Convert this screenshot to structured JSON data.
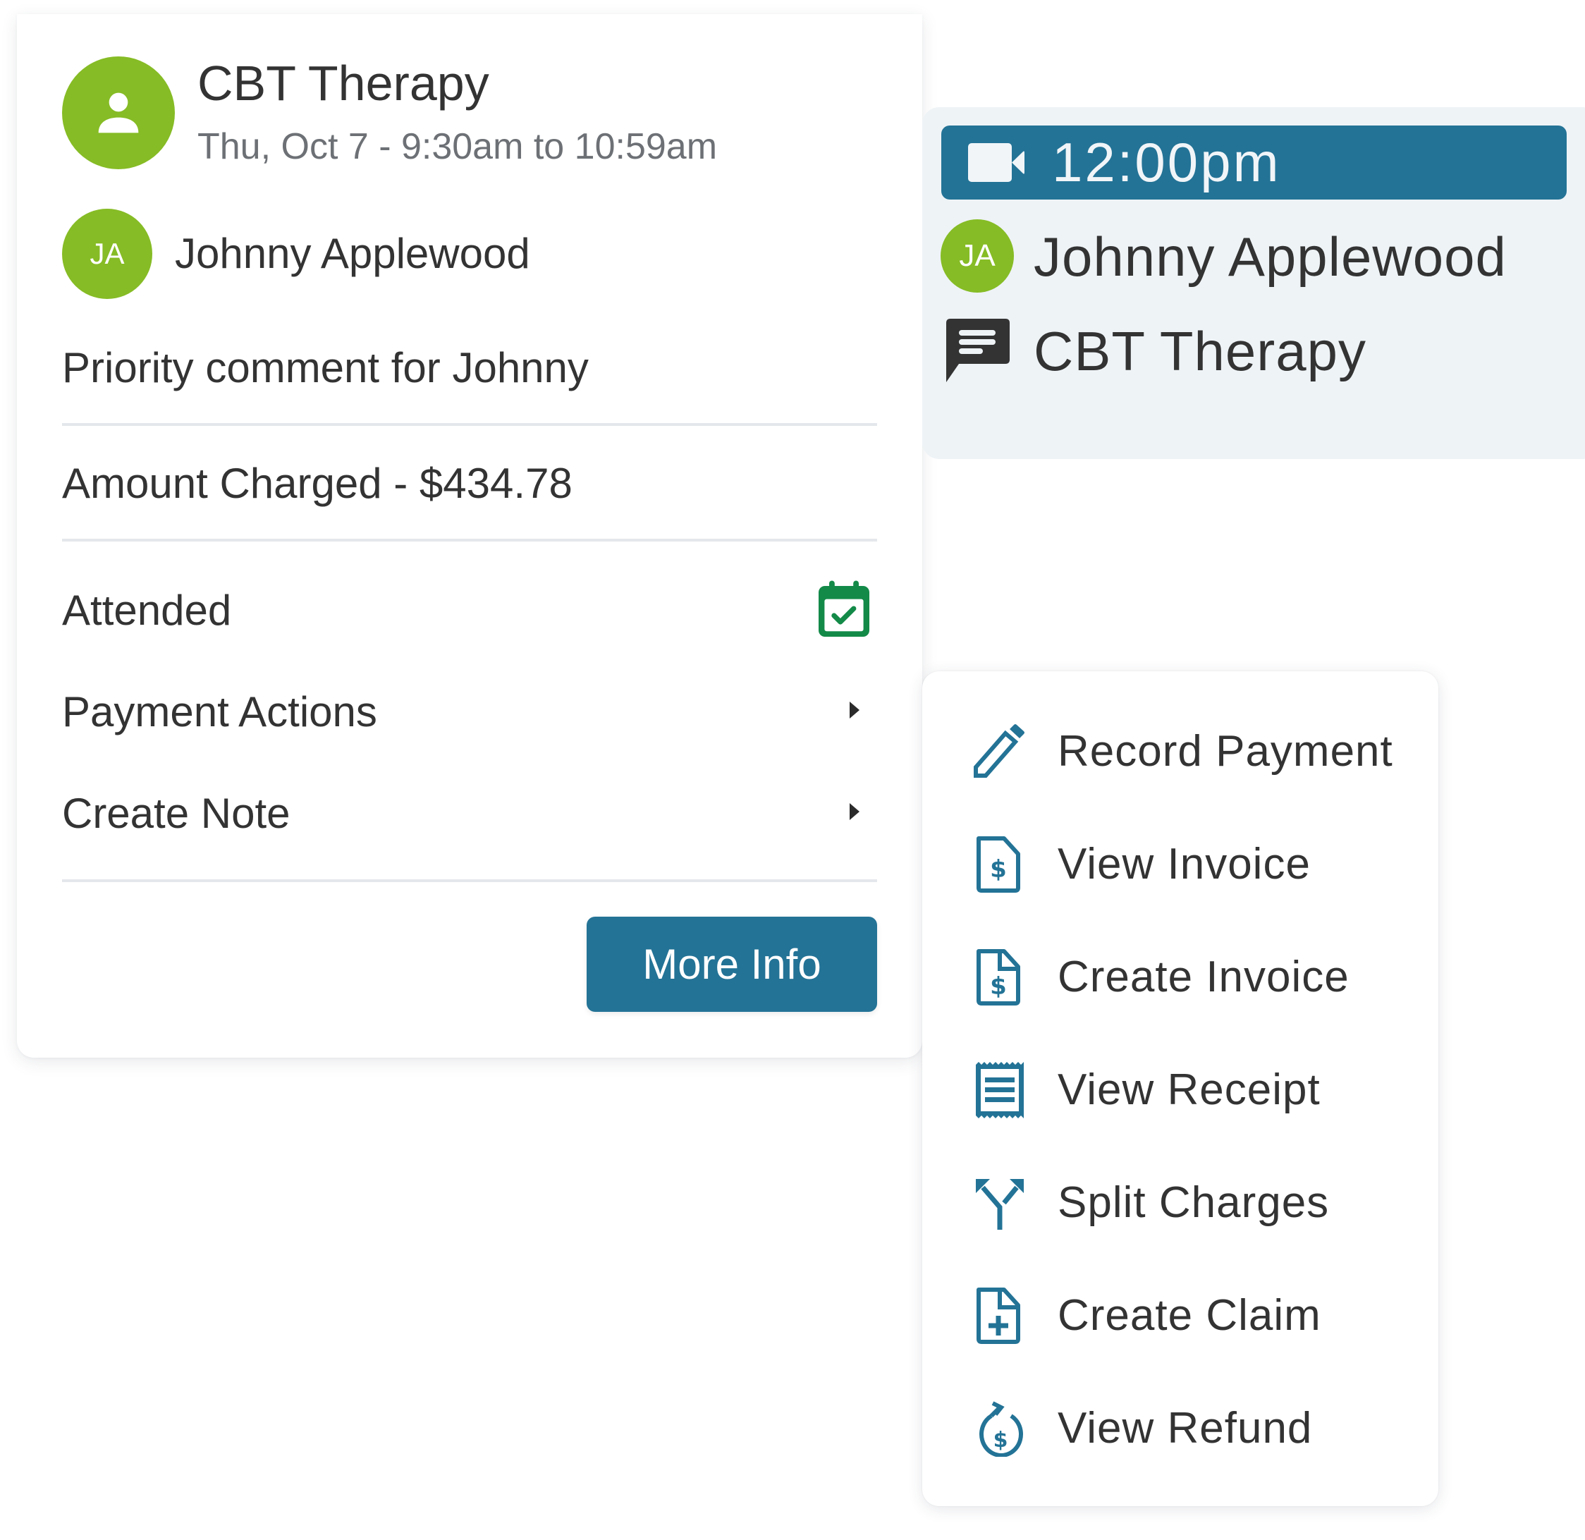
{
  "appointment_card": {
    "service_title": "CBT Therapy",
    "datetime": "Thu, Oct 7 - 9:30am to 10:59am",
    "service_icon": "person-icon",
    "client": {
      "initials": "JA",
      "name": "Johnny Applewood"
    },
    "priority_comment": "Priority comment for Johnny",
    "amount_charged": "Amount Charged - $434.78",
    "status": {
      "label": "Attended",
      "icon": "calendar-check-icon",
      "color": "#138a48"
    },
    "actions": [
      {
        "label": "Payment Actions",
        "icon": "caret-right-icon"
      },
      {
        "label": "Create Note",
        "icon": "caret-right-icon"
      }
    ],
    "more_info_button": "More Info"
  },
  "event_preview": {
    "time": "12:00pm",
    "time_icon": "video-camera-icon",
    "client": {
      "initials": "JA",
      "name": "Johnny Applewood"
    },
    "service": "CBT Therapy",
    "service_icon": "comment-icon"
  },
  "payment_actions_menu": {
    "items": [
      {
        "label": "Record Payment",
        "icon": "pencil-icon"
      },
      {
        "label": "View Invoice",
        "icon": "invoice-dollar-icon"
      },
      {
        "label": "Create Invoice",
        "icon": "invoice-dollar-icon"
      },
      {
        "label": "View Receipt",
        "icon": "receipt-icon"
      },
      {
        "label": "Split Charges",
        "icon": "split-arrows-icon"
      },
      {
        "label": "Create Claim",
        "icon": "file-plus-icon"
      },
      {
        "label": "View Refund",
        "icon": "refund-dollar-icon"
      }
    ]
  },
  "colors": {
    "brand_blue": "#237396",
    "avatar_green": "#86bc25",
    "attended_green": "#138a48",
    "event_bg": "#eef3f6",
    "text_dark": "#333333",
    "text_muted": "#6d7176"
  }
}
